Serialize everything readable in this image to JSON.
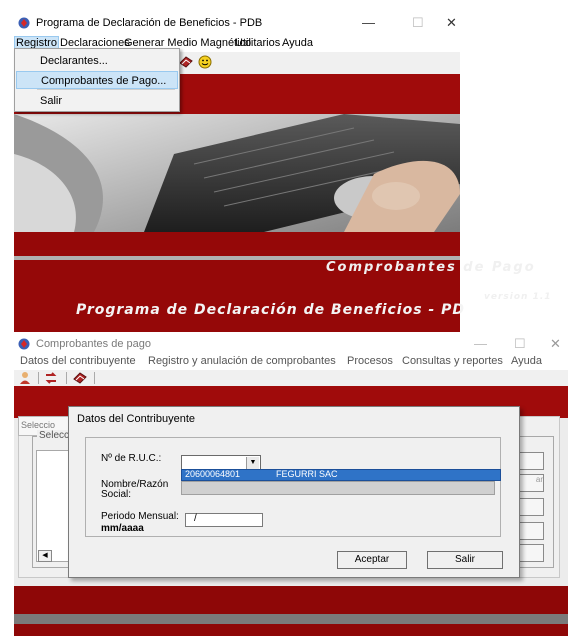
{
  "window1": {
    "title": "Programa de Declaración de Beneficios - PDB",
    "app_icon": "pdb-app-icon",
    "controls": {
      "minimize": "—",
      "maximize": "☐",
      "close": "✕"
    },
    "menu": [
      "Registro",
      "Declaraciones",
      "Generar Medio Magnético",
      "Utilitarios",
      "Ayuda"
    ],
    "dropdown": {
      "items": [
        "Declarantes...",
        "Comprobantes de Pago...",
        "Salir"
      ],
      "selected_index": 1
    },
    "toolbar_icons": [
      "book-icon",
      "smiley-icon"
    ],
    "banner": "Programa de Declaración de Beneficios - PD"
  },
  "window2": {
    "title": "Comprobantes de pago",
    "controls": {
      "minimize": "—",
      "maximize": "☐",
      "close": "✕"
    },
    "menu": [
      "Datos del contribuyente",
      "Registro y anulación de comprobantes",
      "Procesos",
      "Consultas y reportes",
      "Ayuda"
    ],
    "toolbar_icons": [
      "person-icon",
      "exchange-icon",
      "book-icon"
    ],
    "background_tab": "Seleccio",
    "background_group": "Selecc",
    "background_button": "ar",
    "banner": "Comprobantes de Pago",
    "version": "version 1.1"
  },
  "dialog": {
    "title": "Datos del Contribuyente",
    "ruc_label": "Nº de R.U.C.:",
    "ruc_value": "",
    "dropdown_option": {
      "ruc": "20600064801",
      "name": "FEGURRI SAC"
    },
    "name_label_1": "Nombre/Razón",
    "name_label_2": "Social:",
    "period_label": "Periodo Mensual:",
    "period_format": "mm/aaaa",
    "period_value": "/",
    "accept_button": "Aceptar",
    "exit_button": "Salir"
  },
  "colors": {
    "accent_red": "#a00b0b",
    "selection_blue": "#2f73c7",
    "menu_highlight": "#cce4f7"
  }
}
